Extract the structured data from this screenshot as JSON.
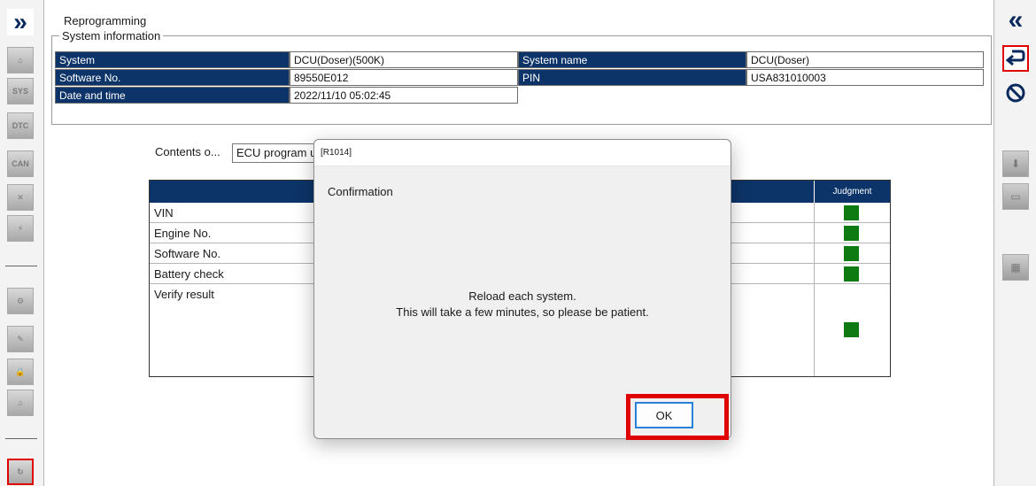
{
  "screen": {
    "title": "Reprogramming",
    "system_info": {
      "legend": "System information",
      "rows": [
        {
          "label1": "System",
          "value1": "DCU(Doser)(500K)",
          "label2": "System name",
          "value2": "DCU(Doser)"
        },
        {
          "label1": "Software No.",
          "value1": "89550E012",
          "label2": "PIN",
          "value2": "USA831010003"
        },
        {
          "label1": "Date and time",
          "value1": "2022/11/10 05:02:45"
        }
      ]
    },
    "contents": {
      "label": "Contents o...",
      "selected": "ECU program u"
    },
    "progress_table": {
      "judgment_header": "Judgment",
      "rows": [
        {
          "label": "VIN",
          "judgment": "ok"
        },
        {
          "label": "Engine No.",
          "judgment": "ok"
        },
        {
          "label": "Software No.",
          "judgment": "ok"
        },
        {
          "label": "Battery check",
          "judgment": "ok"
        },
        {
          "label": "Verify result",
          "judgment": "ok"
        }
      ]
    }
  },
  "dialog": {
    "code": "[R1014]",
    "title": "Confirmation",
    "message_line1": "Reload each system.",
    "message_line2": "This will take a few minutes, so please be patient.",
    "ok_label": "OK"
  },
  "toolbar_left": {
    "icons": [
      "expand-icon",
      "home-icon",
      "sys-icon",
      "dtc-icon",
      "can-icon",
      "tools-icon",
      "ecu-icon",
      "settings-grid-icon",
      "edit-grid-icon",
      "lock-grid-icon",
      "tree-grid-icon",
      "reprogram-icon"
    ]
  },
  "toolbar_right": {
    "icons": [
      "collapse-icon",
      "return-icon",
      "stop-icon",
      "download-icon",
      "open-folder-icon",
      "chip-icon"
    ]
  },
  "colors": {
    "header_navy": "#0d3468",
    "judgment_green": "#0e7a12",
    "highlight_red": "#e00000"
  }
}
